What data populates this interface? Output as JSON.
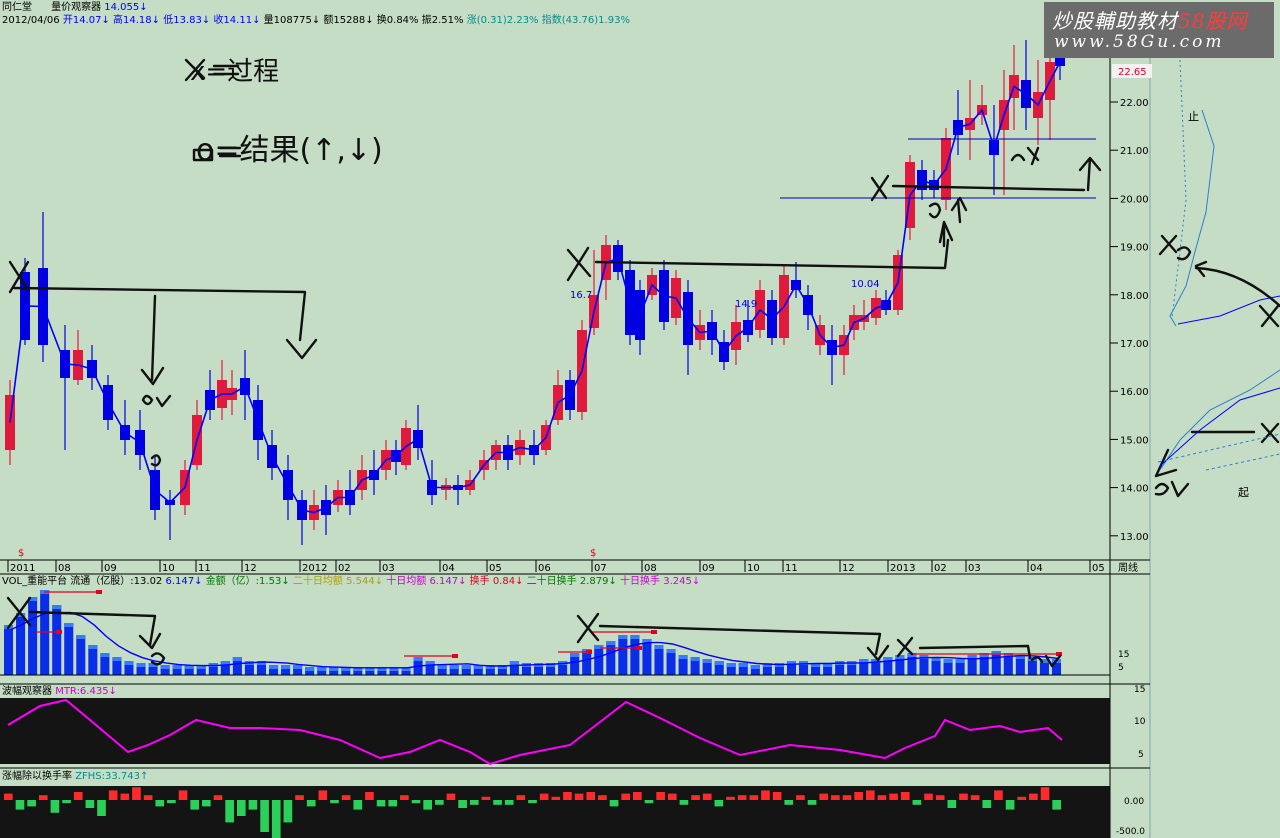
{
  "header": {
    "stock_name": "同仁堂",
    "indicator_name": "量价观察器",
    "indicator_value": "14.055↓",
    "date": "2012/04/06",
    "open": "开14.07↓",
    "high": "高14.18↓",
    "low": "低13.83↓",
    "close": "收14.11↓",
    "volume": "量108775↓",
    "amount": "额15288↓",
    "turnover": "换0.84%",
    "amplitude": "振2.51%",
    "change": "涨(0.31)2.23%",
    "index": "指数(43.76)1.93%"
  },
  "watermark": {
    "line1_a": "炒股輔助教材",
    "line1_b": "58股网",
    "line2": "www.58Gu.com"
  },
  "price_axis": {
    "current_price": "22.65",
    "ticks": [
      "22.00",
      "21.00",
      "20.00",
      "19.00",
      "18.00",
      "17.00",
      "16.00",
      "15.00",
      "14.00",
      "13.00"
    ]
  },
  "time_axis": {
    "labels": [
      "2011",
      "08",
      "09",
      "10",
      "11",
      "12",
      "2012",
      "02",
      "03",
      "04",
      "05",
      "06",
      "07",
      "08",
      "09",
      "10",
      "11",
      "12",
      "2013",
      "02",
      "03",
      "04",
      "05"
    ],
    "period_label": "周线",
    "marker": "$"
  },
  "chart_annotations": {
    "label_16": "16.7",
    "label_14": "14.9",
    "label_10": "10.04"
  },
  "handwritten": {
    "legend_x": "x=过程",
    "legend_o": "o=结果(↑,↓)",
    "start": "起",
    "stop": "止"
  },
  "volume_panel": {
    "name": "VOL_重能平台",
    "float_shares": "流通（亿股）:13.02",
    "value": "6.147↓",
    "amount": "金额（亿）:1.53↓",
    "ma20_amount": "二十日均额 5.544↓",
    "ma10_amount": "十日均额 6.147↓",
    "turnover": "换手 0.84↓",
    "ma20_turnover": "二十日换手 2.879↓",
    "ma10_turnover": "十日换手 3.245↓",
    "axis_ticks": [
      "15",
      "5"
    ]
  },
  "mtr_panel": {
    "name": "波幅观察器",
    "value": "MTR:6.435↓",
    "axis_ticks": [
      "15",
      "10",
      "5"
    ]
  },
  "zfhs_panel": {
    "name": "涨幅除以换手率",
    "value": "ZFHS:33.743↑",
    "axis_ticks": [
      "0.00",
      "-500.0"
    ]
  },
  "colors": {
    "background": "#c5dcc5",
    "up_candle": "#e01a3c",
    "down_candle": "#0000e0",
    "ma_line": "#0000ff",
    "mtr_line": "#ff00ff",
    "grid": "#7fa7a7"
  }
}
